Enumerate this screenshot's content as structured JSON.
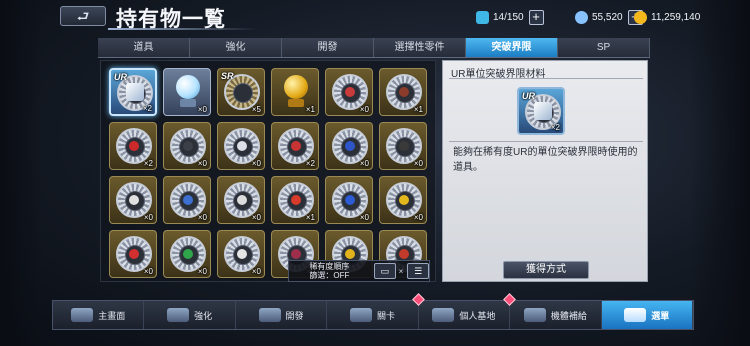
{
  "header": {
    "back_label": "⮐",
    "title": "持有物一覧",
    "resources": [
      {
        "icon": "energy-icon",
        "value": "14/150",
        "color": "#3fb8e8"
      },
      {
        "icon": "gem-icon",
        "value": "55,520",
        "color": "#88c3ff"
      },
      {
        "icon": "coin-icon",
        "value": "11,259,140",
        "color": "#f4b81c"
      }
    ]
  },
  "tabs": [
    "道具",
    "強化",
    "開發",
    "選擇性零件",
    "突破界限",
    "SP"
  ],
  "active_tab": "突破界限",
  "items": [
    {
      "tag": "UR",
      "count": "×2",
      "kind": "ur"
    },
    {
      "tag": "",
      "count": "×0",
      "kind": "crystal"
    },
    {
      "tag": "SR",
      "count": "×5",
      "kind": "sr"
    },
    {
      "tag": "",
      "count": "×1",
      "kind": "gold"
    },
    {
      "tag": "",
      "count": "×0",
      "kind": "gear",
      "mark": "#c93a3a"
    },
    {
      "tag": "",
      "count": "×1",
      "kind": "gear",
      "mark": "#8a3b2a"
    },
    {
      "tag": "",
      "count": "×2",
      "kind": "gear",
      "mark": "#cc2a2a"
    },
    {
      "tag": "",
      "count": "×0",
      "kind": "gear",
      "mark": "#3b3f46"
    },
    {
      "tag": "",
      "count": "×0",
      "kind": "gear",
      "mark": "#dcdfe5"
    },
    {
      "tag": "",
      "count": "×2",
      "kind": "gear",
      "mark": "#c83333"
    },
    {
      "tag": "",
      "count": "×0",
      "kind": "gear",
      "mark": "#2f56c9"
    },
    {
      "tag": "",
      "count": "×0",
      "kind": "gear",
      "mark": "#3a3a3a"
    },
    {
      "tag": "",
      "count": "×0",
      "kind": "gear",
      "mark": "#e0e0e0"
    },
    {
      "tag": "",
      "count": "×0",
      "kind": "gear",
      "mark": "#3c6fd0"
    },
    {
      "tag": "",
      "count": "×0",
      "kind": "gear",
      "mark": "#dcdcdc"
    },
    {
      "tag": "",
      "count": "×1",
      "kind": "gear",
      "mark": "#d83b2b"
    },
    {
      "tag": "",
      "count": "×0",
      "kind": "gear",
      "mark": "#2d5bd4"
    },
    {
      "tag": "",
      "count": "×0",
      "kind": "gear",
      "mark": "#e2b81c"
    },
    {
      "tag": "",
      "count": "×0",
      "kind": "gear",
      "mark": "#d23030"
    },
    {
      "tag": "",
      "count": "×0",
      "kind": "gear",
      "mark": "#2fa44a"
    },
    {
      "tag": "",
      "count": "×0",
      "kind": "gear",
      "mark": "#e5e5e5"
    },
    {
      "tag": "",
      "count": "×0",
      "kind": "gear",
      "mark": "#9e2f4c"
    },
    {
      "tag": "",
      "count": "",
      "kind": "gear",
      "mark": "#e1b21c"
    },
    {
      "tag": "",
      "count": "",
      "kind": "gear",
      "mark": "#c23b2a"
    }
  ],
  "sort": {
    "line1": "稀有度順序",
    "line2": "篩選：OFF",
    "view_btn": "▭",
    "x": "×",
    "order_btn": "☰"
  },
  "detail": {
    "title": "UR單位突破界限材料",
    "tag": "UR",
    "count": "×2",
    "description": "能夠在稀有度UR的單位突破界限時使用的道具。",
    "obtain_button": "獲得方式"
  },
  "nav": [
    {
      "label": "主畫面",
      "icon": "home-icon",
      "alert": false
    },
    {
      "label": "強化",
      "icon": "wrench-icon",
      "alert": false
    },
    {
      "label": "開發",
      "icon": "factory-icon",
      "alert": false
    },
    {
      "label": "關卡",
      "icon": "rifle-icon",
      "alert": false
    },
    {
      "label": "個人基地",
      "icon": "base-icon",
      "alert": true
    },
    {
      "label": "機體補給",
      "icon": "supply-icon",
      "alert": true
    },
    {
      "label": "選單",
      "icon": "menu-icon",
      "alert": false,
      "active": true
    }
  ]
}
